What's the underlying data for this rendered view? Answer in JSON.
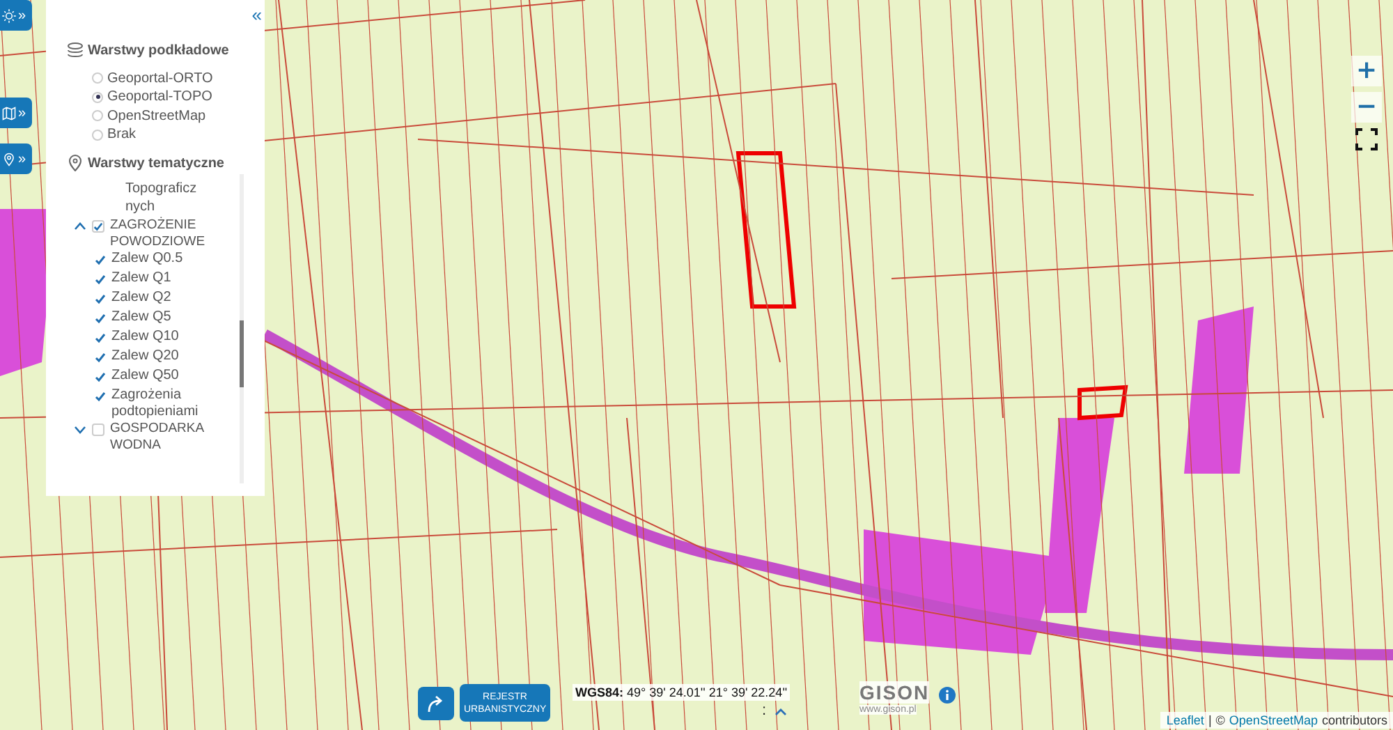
{
  "side_toolbar": [
    {
      "arrow": "»"
    },
    {
      "arrow": "»"
    },
    {
      "arrow": "»"
    }
  ],
  "layer_panel": {
    "collapse": "«",
    "base_layers": {
      "title": "Warstwy podkładowe",
      "options": [
        {
          "label": "Geoportal-ORTO",
          "selected": false
        },
        {
          "label": "Geoportal-TOPO",
          "selected": true
        },
        {
          "label": "OpenStreetMap",
          "selected": false
        },
        {
          "label": "Brak",
          "selected": false
        }
      ]
    },
    "thematic_layers": {
      "title": "Warstwy tematyczne",
      "items": [
        {
          "kind": "caption",
          "label": "Topograficznych"
        },
        {
          "kind": "group",
          "label": "ZAGROŻENIE POWODZIOWE",
          "expanded": true,
          "checked": true,
          "children": [
            {
              "label": "Zalew Q0.5",
              "checked": true
            },
            {
              "label": "Zalew Q1",
              "checked": true
            },
            {
              "label": "Zalew Q2",
              "checked": true
            },
            {
              "label": "Zalew Q5",
              "checked": true
            },
            {
              "label": "Zalew Q10",
              "checked": true
            },
            {
              "label": "Zalew Q20",
              "checked": true
            },
            {
              "label": "Zalew Q50",
              "checked": true
            },
            {
              "label": "Zagrożenia podtopieniami",
              "checked": true
            }
          ]
        },
        {
          "kind": "group",
          "label": "GOSPODARKA WODNA",
          "expanded": false,
          "checked": false
        }
      ]
    }
  },
  "map_controls": {
    "zoom_in": "+",
    "zoom_out": "−"
  },
  "bottom_bar": {
    "button": "REJESTR URBANISTYCZNY",
    "coordinates": {
      "label": "WGS84:",
      "value": "49° 39' 24.01'' 21° 39' 22.24''"
    },
    "brand": "GISON",
    "website": "www.gison.pl",
    "toggle": ":"
  },
  "attribution": {
    "leaflet": "Leaflet",
    "separator": "|",
    "osm_prefix": "©",
    "osm": "OpenStreetMap",
    "suffix": "contributors"
  }
}
